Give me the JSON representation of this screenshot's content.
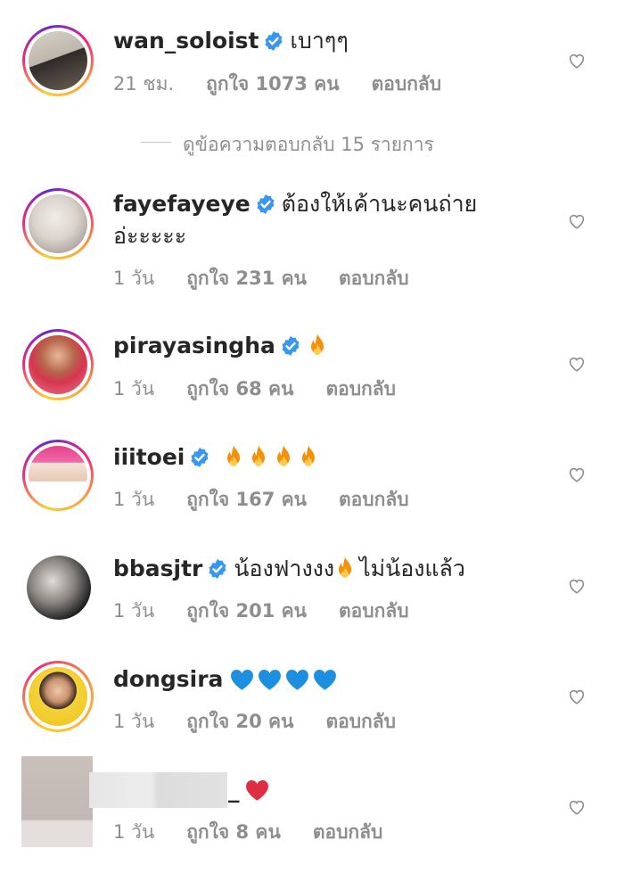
{
  "comments": [
    {
      "username": "wan_soloist",
      "text": "เบาๆๆ",
      "time": "21 ชม.",
      "likes": "ถูกใจ 1073 คน",
      "reply": "ตอบกลับ"
    },
    {
      "username": "fayefayeye",
      "text": "ต้องให้เค้านะคนถ่ายอ่ะะะะะ",
      "time": "1 วัน",
      "likes": "ถูกใจ 231 คน",
      "reply": "ตอบกลับ"
    },
    {
      "username": "pirayasingha",
      "text": "",
      "time": "1 วัน",
      "likes": "ถูกใจ 68 คน",
      "reply": "ตอบกลับ"
    },
    {
      "username": "iiitoei",
      "text": "",
      "time": "1 วัน",
      "likes": "ถูกใจ 167 คน",
      "reply": "ตอบกลับ"
    },
    {
      "username": "bbasjtr",
      "text_before": "น้องฟางงง",
      "text_after": "ไม่น้องแล้ว",
      "time": "1 วัน",
      "likes": "ถูกใจ 201 คน",
      "reply": "ตอบกลับ"
    },
    {
      "username": "dongsira",
      "text": "",
      "time": "1 วัน",
      "likes": "ถูกใจ 20 คน",
      "reply": "ตอบกลับ"
    },
    {
      "username": "_",
      "text": "",
      "time": "1 วัน",
      "likes": "ถูกใจ 8 คน",
      "reply": "ตอบกลับ"
    }
  ],
  "view_replies": "ดูข้อความตอบกลับ 15 รายการ",
  "icons": {
    "verified": "verified-badge-icon",
    "heart": "heart-outline-icon",
    "fire": "fire-emoji",
    "blue_heart": "blue-heart-emoji",
    "red_heart": "red-heart-emoji"
  },
  "colors": {
    "verified": "#3897f0",
    "meta": "#8e8e8e",
    "text": "#262626"
  }
}
